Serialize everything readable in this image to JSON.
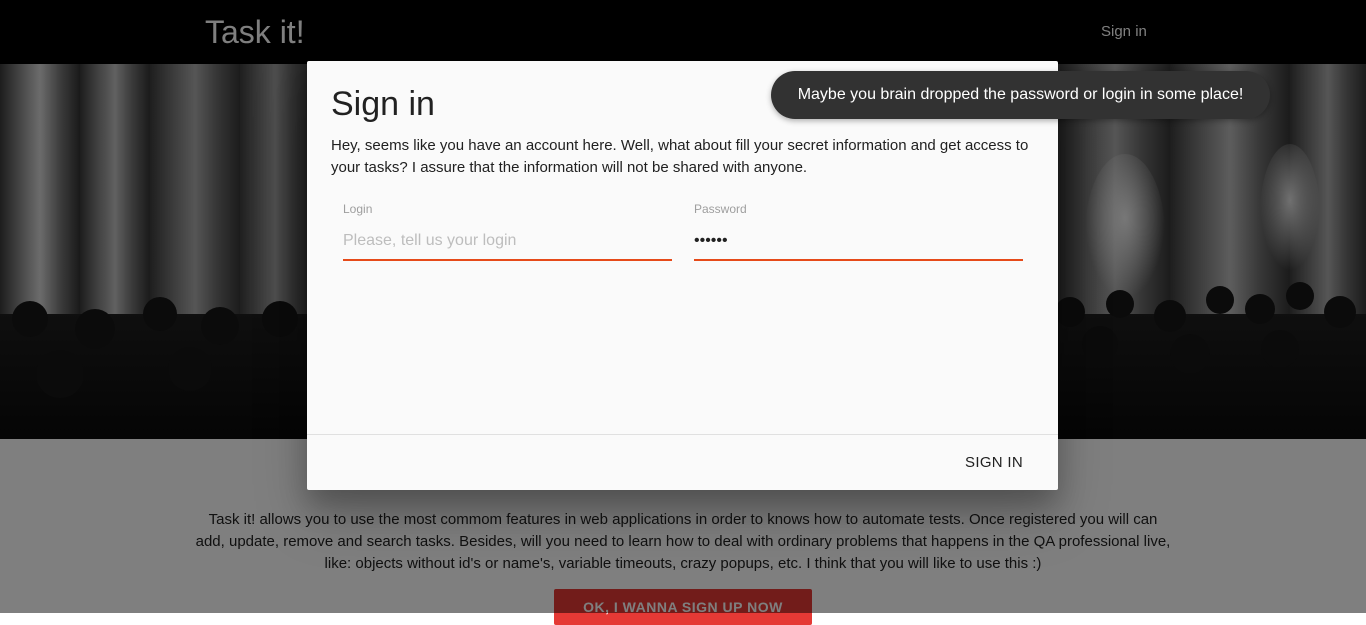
{
  "navbar": {
    "brand": "Task it!",
    "signin_link": "Sign in"
  },
  "content": {
    "heading": "",
    "description": "Task it! allows you to use the most commom features in web applications in order to knows how to automate tests. Once registered you will can add, update, remove and search tasks. Besides, will you need to learn how to deal with ordinary problems that happens in the QA professional live, like: objects without id's or name's, variable timeouts, crazy popups, etc. I think that you will like to use this :)",
    "cta_label": "OK, I WANNA SIGN UP NOW"
  },
  "modal": {
    "title": "Sign in",
    "description": "Hey, seems like you have an account here. Well, what about fill your secret information and get access to your tasks? I assure that the information will not be shared with anyone.",
    "login": {
      "label": "Login",
      "placeholder": "Please, tell us your login",
      "value": ""
    },
    "password": {
      "label": "Password",
      "value": "••••••"
    },
    "submit_label": "SIGN IN"
  },
  "toast": {
    "message": "Maybe you brain dropped the password or login in some place!"
  },
  "colors": {
    "navbar": "#000000",
    "accent": "#e64a19",
    "cta": "#e53935",
    "toast": "#323232"
  }
}
